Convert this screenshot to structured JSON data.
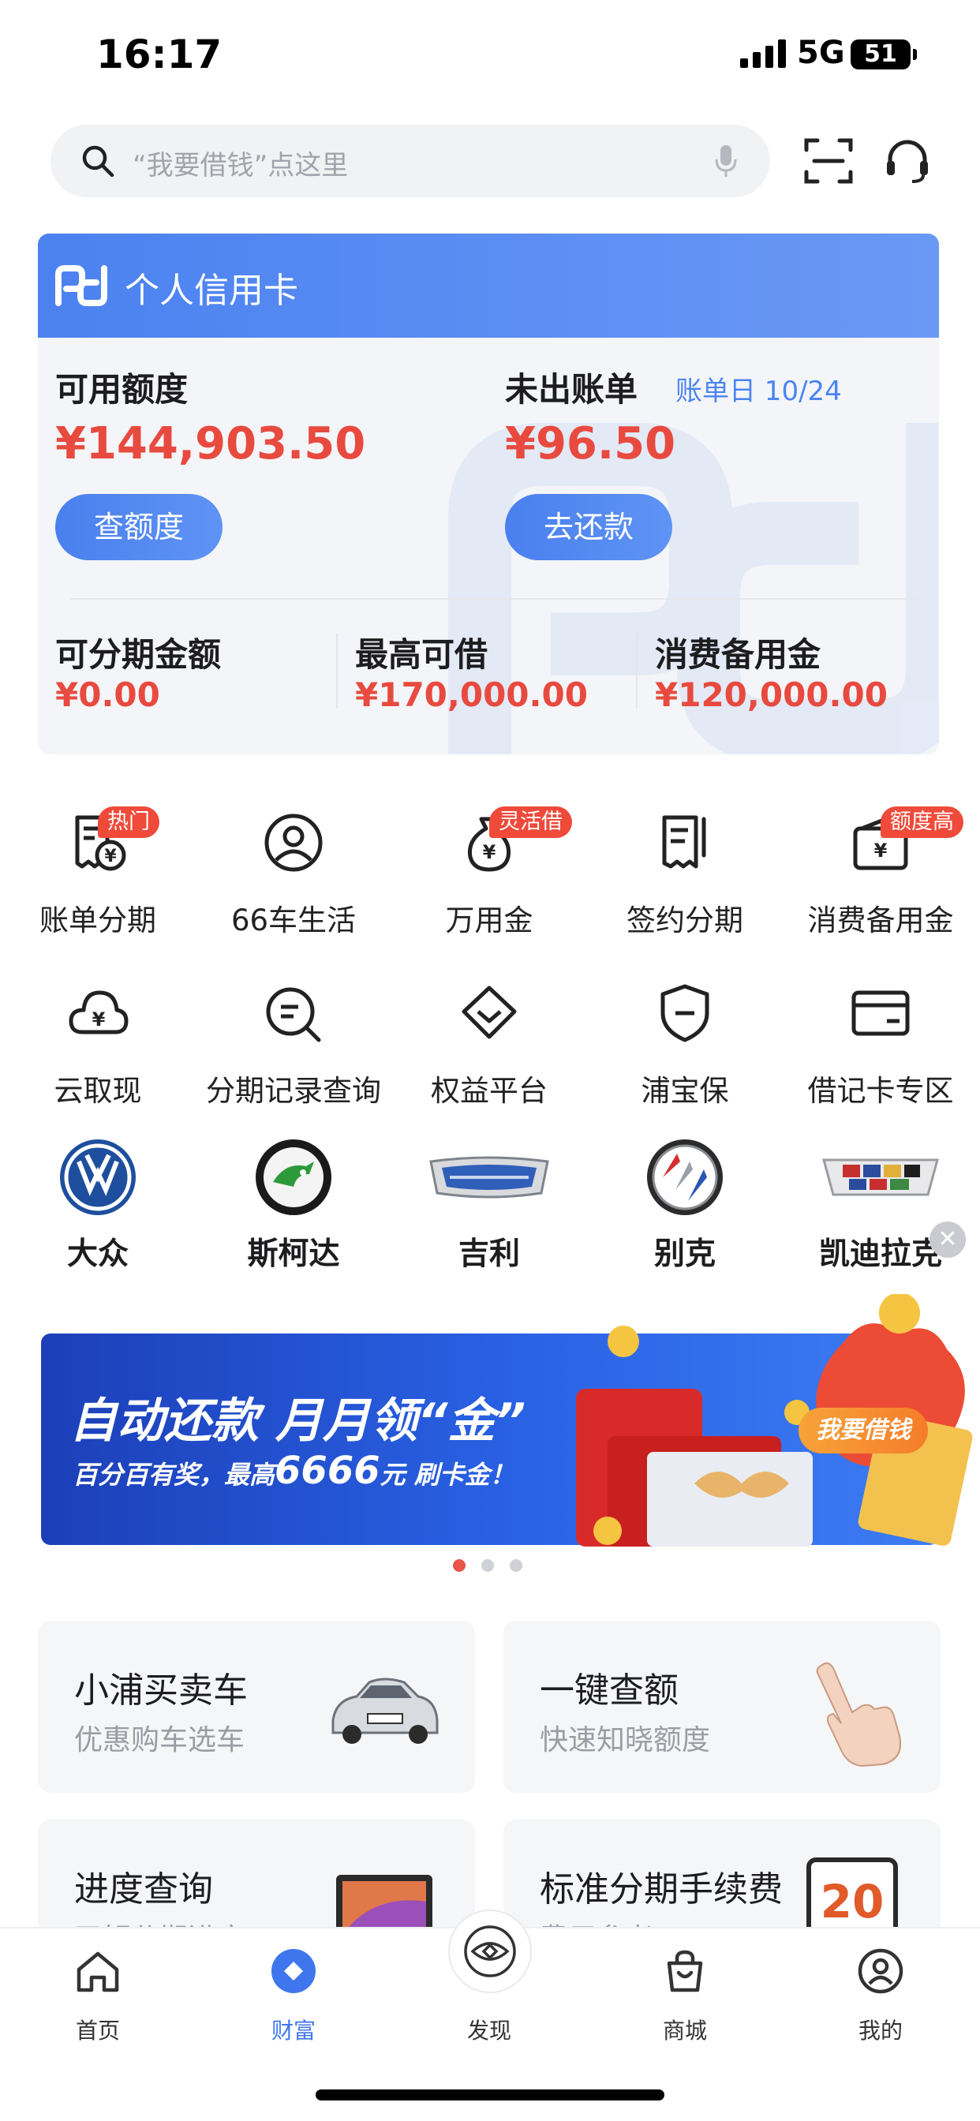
{
  "status_bar": {
    "time": "16:17",
    "network": "5G",
    "battery": "51"
  },
  "search": {
    "placeholder": "“我要借钱”点这里"
  },
  "card": {
    "title": "个人信用卡",
    "available_label": "可用额度",
    "available_amount": "¥144,903.50",
    "check_limit_button": "查额度",
    "unbilled_label": "未出账单",
    "bill_day": "账单日 10/24",
    "unbilled_amount": "¥96.50",
    "repay_button": "去还款",
    "metrics": [
      {
        "label": "可分期金额",
        "value": "¥0.00"
      },
      {
        "label": "最高可借",
        "value": "¥170,000.00"
      },
      {
        "label": "消费备用金",
        "value": "¥120,000.00"
      }
    ]
  },
  "grid_row1": [
    {
      "label": "账单分期",
      "badge": "热门",
      "icon": "bill-installment-icon"
    },
    {
      "label": "66车生活",
      "badge": "",
      "icon": "car-life-icon"
    },
    {
      "label": "万用金",
      "badge": "灵活借",
      "icon": "money-bag-icon"
    },
    {
      "label": "签约分期",
      "badge": "",
      "icon": "contract-icon"
    },
    {
      "label": "消费备用金",
      "badge": "额度高",
      "icon": "wallet-icon"
    }
  ],
  "grid_row2": [
    {
      "label": "云取现",
      "icon": "cloud-cash-icon"
    },
    {
      "label": "分期记录查询",
      "icon": "record-search-icon"
    },
    {
      "label": "权益平台",
      "icon": "diamond-icon"
    },
    {
      "label": "浦宝保",
      "icon": "shield-icon"
    },
    {
      "label": "借记卡专区",
      "icon": "debit-card-icon"
    }
  ],
  "brands": [
    {
      "label": "大众",
      "icon": "volkswagen-logo-icon"
    },
    {
      "label": "斯柯达",
      "icon": "skoda-logo-icon"
    },
    {
      "label": "吉利",
      "icon": "geely-logo-icon"
    },
    {
      "label": "别克",
      "icon": "buick-logo-icon"
    },
    {
      "label": "凯迪拉克",
      "icon": "cadillac-logo-icon"
    }
  ],
  "banner": {
    "title": "自动还款 月月领“金”",
    "subtitle_pre": "百分百有奖，最高",
    "subtitle_num": "6666",
    "subtitle_post": "元 刷卡金！",
    "cta": "我要借钱",
    "page_count": 3,
    "active_page": 1
  },
  "feature_cards": [
    {
      "title": "小浦买卖车",
      "subtitle": "优惠购车选车",
      "icon": "car-photo-icon"
    },
    {
      "title": "一键查额",
      "subtitle": "快速知晓额度",
      "icon": "finger-tap-icon"
    },
    {
      "title": "进度查询",
      "subtitle": "了解分期进度",
      "icon": "laptop-icon"
    },
    {
      "title": "标准分期手续费",
      "subtitle": "费用参考",
      "icon": "calendar-icon",
      "calendar_number": "20"
    }
  ],
  "tabbar": [
    {
      "label": "首页",
      "icon": "home-icon"
    },
    {
      "label": "财富",
      "icon": "wealth-icon"
    },
    {
      "label": "发现",
      "icon": "discover-eye-icon"
    },
    {
      "label": "商城",
      "icon": "shopping-bag-icon"
    },
    {
      "label": "我的",
      "icon": "profile-icon"
    }
  ],
  "colors": {
    "accent": "#4a80ee",
    "amount_red": "#e84a3f",
    "badge_red": "#ef4a3a"
  }
}
